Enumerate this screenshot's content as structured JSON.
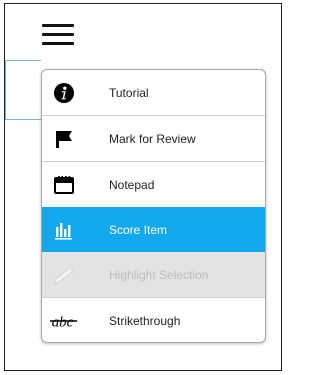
{
  "menu_button": {
    "icon": "hamburger-menu-icon"
  },
  "menu": {
    "items": [
      {
        "label": "Tutorial",
        "icon": "info-icon",
        "state": "normal"
      },
      {
        "label": "Mark for Review",
        "icon": "flag-icon",
        "state": "normal"
      },
      {
        "label": "Notepad",
        "icon": "notepad-icon",
        "state": "normal"
      },
      {
        "label": "Score Item",
        "icon": "bar-chart-icon",
        "state": "selected"
      },
      {
        "label": "Highlight Selection",
        "icon": "highlighter-icon",
        "state": "disabled"
      },
      {
        "label": "Strikethrough",
        "icon": "strikethrough-icon",
        "state": "normal"
      }
    ]
  },
  "colors": {
    "selected_bg": "#12a8ec",
    "disabled_bg": "#e3e3e3",
    "disabled_text": "#bdbdbd",
    "guide_line": "#7fb3d5"
  }
}
